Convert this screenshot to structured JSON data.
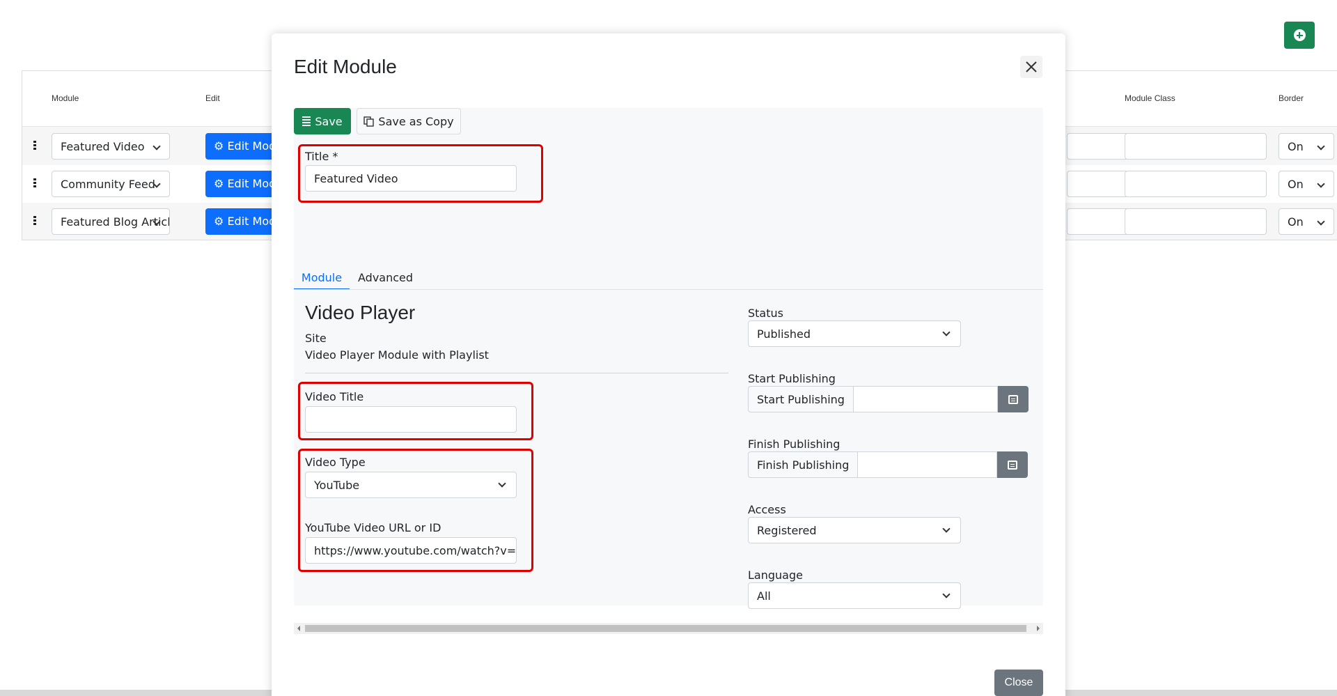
{
  "background": {
    "add_button_icon": "plus-circle-icon",
    "columns": {
      "module": "Module",
      "edit": "Edit",
      "module_class": "Module Class",
      "border": "Border"
    },
    "rows": [
      {
        "module": "Featured Video",
        "edit_label": "Edit Module",
        "border": "On"
      },
      {
        "module": "Community Feed",
        "edit_label": "Edit Module",
        "border": "On"
      },
      {
        "module": "Featured Blog Article",
        "edit_label": "Edit Module",
        "border": "On"
      }
    ]
  },
  "modal": {
    "title": "Edit Module",
    "close_icon": "close-icon",
    "toolbar": {
      "save_label": "Save",
      "save_copy_label": "Save as Copy"
    },
    "title_field": {
      "label": "Title *",
      "value": "Featured Video"
    },
    "tabs": [
      {
        "label": "Module"
      },
      {
        "label": "Advanced"
      }
    ],
    "module_info": {
      "heading": "Video Player",
      "site": "Site",
      "description": "Video Player Module with Playlist"
    },
    "video_title": {
      "label": "Video Title",
      "value": ""
    },
    "video_type": {
      "label": "Video Type",
      "value": "YouTube"
    },
    "youtube_url": {
      "label": "YouTube Video URL or ID",
      "value": "https://www.youtube.com/watch?v=x"
    },
    "status": {
      "label": "Status",
      "value": "Published"
    },
    "start_publishing": {
      "label": "Start Publishing",
      "addon": "Start Publishing",
      "value": ""
    },
    "finish_publishing": {
      "label": "Finish Publishing",
      "addon": "Finish Publishing",
      "value": ""
    },
    "access": {
      "label": "Access",
      "value": "Registered"
    },
    "language": {
      "label": "Language",
      "value": "All"
    },
    "close_label": "Close"
  },
  "colors": {
    "primary": "#0d6efd",
    "success": "#198754",
    "secondary": "#6c757d",
    "highlight": "#e00000"
  }
}
